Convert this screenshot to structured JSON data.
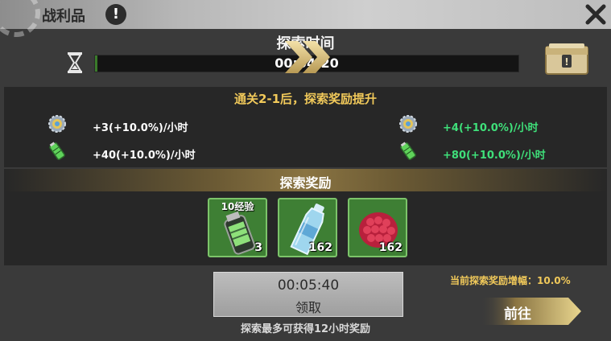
{
  "header": {
    "title": "战利品",
    "info_icon": "info-icon",
    "close_icon": "close-icon"
  },
  "explore_time": {
    "title": "探索时间",
    "time": "00:04:20",
    "progress": 0.006
  },
  "upgrade": {
    "title": "通关2-1后，探索奖励提升",
    "current": [
      {
        "icon": "gear-coin-icon",
        "rate": "+3(+10.0%)/小时"
      },
      {
        "icon": "battery-icon",
        "rate": "+40(+10.0%)/小时"
      }
    ],
    "next": [
      {
        "icon": "gear-coin-icon",
        "rate": "+4(+10.0%)/小时"
      },
      {
        "icon": "battery-icon",
        "rate": "+80(+10.0%)/小时"
      }
    ],
    "colors": {
      "current": "#ffffff",
      "next": "#3fe07a",
      "title": "#f1c95a"
    }
  },
  "rewards": {
    "title": "探索奖励",
    "items": [
      {
        "icon": "exp-canister-icon",
        "tag": "10经验",
        "count": "3"
      },
      {
        "icon": "water-bottle-icon",
        "tag": "",
        "count": "162"
      },
      {
        "icon": "raspberry-icon",
        "tag": "",
        "count": "162"
      }
    ]
  },
  "claim": {
    "countdown": "00:05:40",
    "label": "领取"
  },
  "max_note": "探索最多可获得12小时奖励",
  "boost_text": "当前探索奖励增幅：10.0%",
  "goto_label": "前往"
}
